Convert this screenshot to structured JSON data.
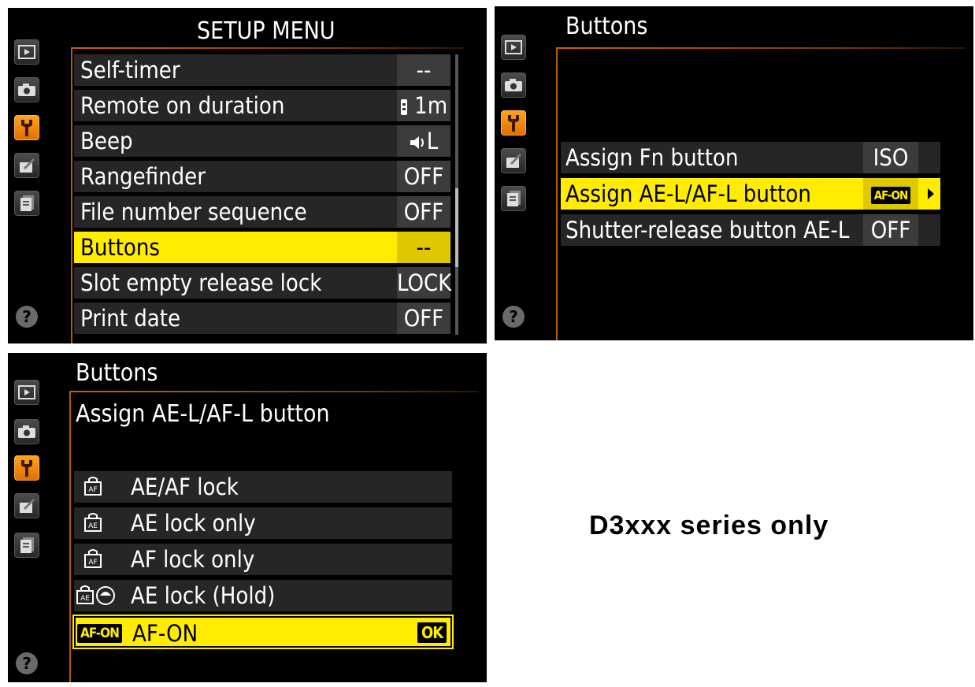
{
  "setup_menu": {
    "title": "SETUP MENU",
    "items": [
      {
        "label": "Self-timer",
        "value": "--"
      },
      {
        "label": "Remote on duration",
        "value": "1m"
      },
      {
        "label": "Beep",
        "value": "L"
      },
      {
        "label": "Rangefinder",
        "value": "OFF"
      },
      {
        "label": "File number sequence",
        "value": "OFF"
      },
      {
        "label": "Buttons",
        "value": "--"
      },
      {
        "label": "Slot empty release lock",
        "value": "LOCK"
      },
      {
        "label": "Print date",
        "value": "OFF"
      }
    ],
    "selected_index": 5
  },
  "buttons_menu": {
    "title": "Buttons",
    "items": [
      {
        "label": "Assign Fn button",
        "value": "ISO"
      },
      {
        "label": "Assign AE-L/AF-L button",
        "value": "AF-ON"
      },
      {
        "label": "Shutter-release button AE-L",
        "value": "OFF"
      }
    ],
    "selected_index": 1
  },
  "assign_menu": {
    "title": "Buttons",
    "subtitle": "Assign AE-L/AF-L button",
    "options": [
      {
        "label": "AE/AF lock"
      },
      {
        "label": "AE lock only"
      },
      {
        "label": "AF lock only"
      },
      {
        "label": "AE lock (Hold)"
      },
      {
        "label": "AF-ON",
        "badge": "AF-ON",
        "confirm": "OK"
      }
    ],
    "selected_index": 4
  },
  "help_symbol": "?",
  "note": "D3xxx series only",
  "colors": {
    "highlight": "#ffec00",
    "tab_active": "#f08c00",
    "screen_bg": "#000000"
  }
}
